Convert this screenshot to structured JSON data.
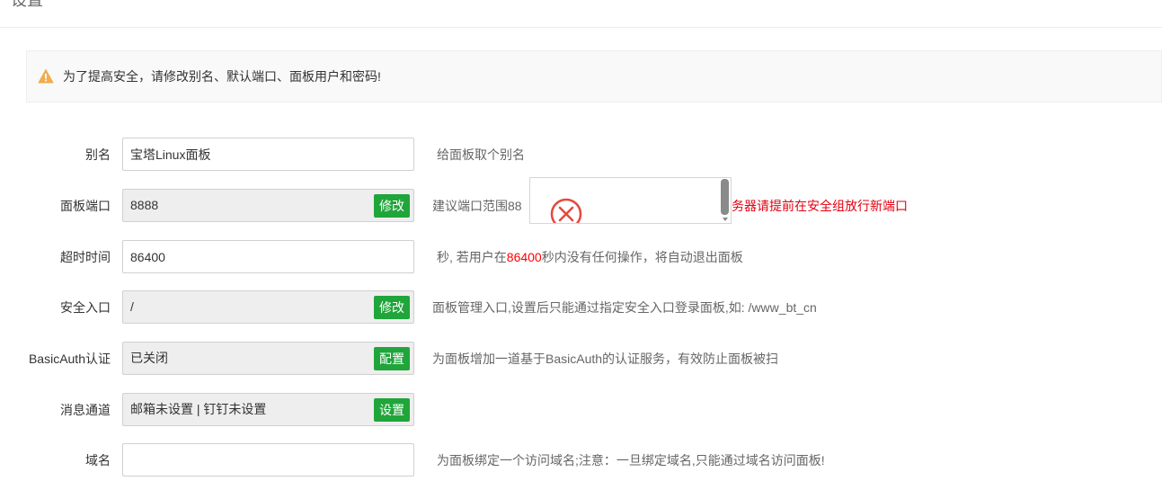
{
  "page": {
    "title": "设置"
  },
  "alert": {
    "icon": "warning-icon",
    "text": "为了提高安全，请修改别名、默认端口、面板用户和密码!"
  },
  "colors": {
    "accent": "#20a53a",
    "warning": "#f0ad4e",
    "error": "#e4000f"
  },
  "form": {
    "alias": {
      "label": "别名",
      "value": "宝塔Linux面板",
      "hint": "给面板取个别名"
    },
    "port": {
      "label": "面板端口",
      "value": "8888",
      "button": "修改",
      "hint": "建议端口范围88",
      "hint_red": "务器请提前在安全组放行新端口"
    },
    "timeout": {
      "label": "超时时间",
      "value": "86400",
      "hint_prefix": "秒, 若用户在",
      "hint_value": "86400",
      "hint_suffix": "秒内没有任何操作，将自动退出面板"
    },
    "security_entry": {
      "label": "安全入口",
      "value": "/",
      "button": "修改",
      "hint": "面板管理入口,设置后只能通过指定安全入口登录面板,如: /www_bt_cn"
    },
    "basic_auth": {
      "label": "BasicAuth认证",
      "value": "已关闭",
      "button": "配置",
      "hint": "为面板增加一道基于BasicAuth的认证服务，有效防止面板被扫"
    },
    "message_channel": {
      "label": "消息通道",
      "value": "邮箱未设置 | 钉钉未设置",
      "button": "设置"
    },
    "domain": {
      "label": "域名",
      "value": "",
      "hint": "为面板绑定一个访问域名;注意：一旦绑定域名,只能通过域名访问面板!"
    }
  },
  "popup": {
    "icon": "error-circle-icon"
  }
}
